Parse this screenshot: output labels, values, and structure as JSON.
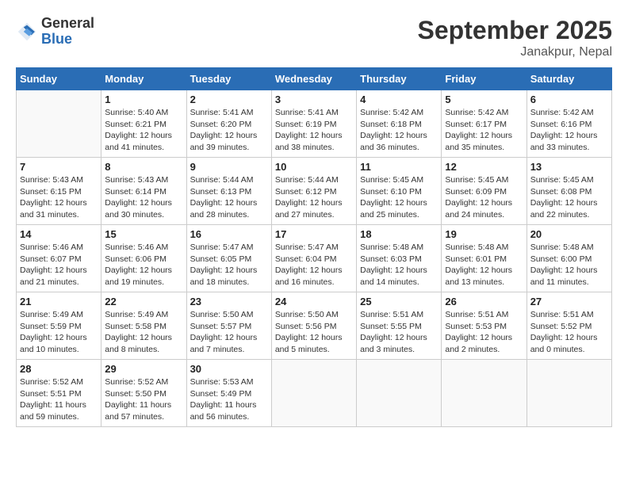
{
  "header": {
    "logo_general": "General",
    "logo_blue": "Blue",
    "month": "September 2025",
    "location": "Janakpur, Nepal"
  },
  "weekdays": [
    "Sunday",
    "Monday",
    "Tuesday",
    "Wednesday",
    "Thursday",
    "Friday",
    "Saturday"
  ],
  "weeks": [
    [
      {
        "day": "",
        "empty": true
      },
      {
        "day": "1",
        "sunrise": "Sunrise: 5:40 AM",
        "sunset": "Sunset: 6:21 PM",
        "daylight": "Daylight: 12 hours and 41 minutes."
      },
      {
        "day": "2",
        "sunrise": "Sunrise: 5:41 AM",
        "sunset": "Sunset: 6:20 PM",
        "daylight": "Daylight: 12 hours and 39 minutes."
      },
      {
        "day": "3",
        "sunrise": "Sunrise: 5:41 AM",
        "sunset": "Sunset: 6:19 PM",
        "daylight": "Daylight: 12 hours and 38 minutes."
      },
      {
        "day": "4",
        "sunrise": "Sunrise: 5:42 AM",
        "sunset": "Sunset: 6:18 PM",
        "daylight": "Daylight: 12 hours and 36 minutes."
      },
      {
        "day": "5",
        "sunrise": "Sunrise: 5:42 AM",
        "sunset": "Sunset: 6:17 PM",
        "daylight": "Daylight: 12 hours and 35 minutes."
      },
      {
        "day": "6",
        "sunrise": "Sunrise: 5:42 AM",
        "sunset": "Sunset: 6:16 PM",
        "daylight": "Daylight: 12 hours and 33 minutes."
      }
    ],
    [
      {
        "day": "7",
        "sunrise": "Sunrise: 5:43 AM",
        "sunset": "Sunset: 6:15 PM",
        "daylight": "Daylight: 12 hours and 31 minutes."
      },
      {
        "day": "8",
        "sunrise": "Sunrise: 5:43 AM",
        "sunset": "Sunset: 6:14 PM",
        "daylight": "Daylight: 12 hours and 30 minutes."
      },
      {
        "day": "9",
        "sunrise": "Sunrise: 5:44 AM",
        "sunset": "Sunset: 6:13 PM",
        "daylight": "Daylight: 12 hours and 28 minutes."
      },
      {
        "day": "10",
        "sunrise": "Sunrise: 5:44 AM",
        "sunset": "Sunset: 6:12 PM",
        "daylight": "Daylight: 12 hours and 27 minutes."
      },
      {
        "day": "11",
        "sunrise": "Sunrise: 5:45 AM",
        "sunset": "Sunset: 6:10 PM",
        "daylight": "Daylight: 12 hours and 25 minutes."
      },
      {
        "day": "12",
        "sunrise": "Sunrise: 5:45 AM",
        "sunset": "Sunset: 6:09 PM",
        "daylight": "Daylight: 12 hours and 24 minutes."
      },
      {
        "day": "13",
        "sunrise": "Sunrise: 5:45 AM",
        "sunset": "Sunset: 6:08 PM",
        "daylight": "Daylight: 12 hours and 22 minutes."
      }
    ],
    [
      {
        "day": "14",
        "sunrise": "Sunrise: 5:46 AM",
        "sunset": "Sunset: 6:07 PM",
        "daylight": "Daylight: 12 hours and 21 minutes."
      },
      {
        "day": "15",
        "sunrise": "Sunrise: 5:46 AM",
        "sunset": "Sunset: 6:06 PM",
        "daylight": "Daylight: 12 hours and 19 minutes."
      },
      {
        "day": "16",
        "sunrise": "Sunrise: 5:47 AM",
        "sunset": "Sunset: 6:05 PM",
        "daylight": "Daylight: 12 hours and 18 minutes."
      },
      {
        "day": "17",
        "sunrise": "Sunrise: 5:47 AM",
        "sunset": "Sunset: 6:04 PM",
        "daylight": "Daylight: 12 hours and 16 minutes."
      },
      {
        "day": "18",
        "sunrise": "Sunrise: 5:48 AM",
        "sunset": "Sunset: 6:03 PM",
        "daylight": "Daylight: 12 hours and 14 minutes."
      },
      {
        "day": "19",
        "sunrise": "Sunrise: 5:48 AM",
        "sunset": "Sunset: 6:01 PM",
        "daylight": "Daylight: 12 hours and 13 minutes."
      },
      {
        "day": "20",
        "sunrise": "Sunrise: 5:48 AM",
        "sunset": "Sunset: 6:00 PM",
        "daylight": "Daylight: 12 hours and 11 minutes."
      }
    ],
    [
      {
        "day": "21",
        "sunrise": "Sunrise: 5:49 AM",
        "sunset": "Sunset: 5:59 PM",
        "daylight": "Daylight: 12 hours and 10 minutes."
      },
      {
        "day": "22",
        "sunrise": "Sunrise: 5:49 AM",
        "sunset": "Sunset: 5:58 PM",
        "daylight": "Daylight: 12 hours and 8 minutes."
      },
      {
        "day": "23",
        "sunrise": "Sunrise: 5:50 AM",
        "sunset": "Sunset: 5:57 PM",
        "daylight": "Daylight: 12 hours and 7 minutes."
      },
      {
        "day": "24",
        "sunrise": "Sunrise: 5:50 AM",
        "sunset": "Sunset: 5:56 PM",
        "daylight": "Daylight: 12 hours and 5 minutes."
      },
      {
        "day": "25",
        "sunrise": "Sunrise: 5:51 AM",
        "sunset": "Sunset: 5:55 PM",
        "daylight": "Daylight: 12 hours and 3 minutes."
      },
      {
        "day": "26",
        "sunrise": "Sunrise: 5:51 AM",
        "sunset": "Sunset: 5:53 PM",
        "daylight": "Daylight: 12 hours and 2 minutes."
      },
      {
        "day": "27",
        "sunrise": "Sunrise: 5:51 AM",
        "sunset": "Sunset: 5:52 PM",
        "daylight": "Daylight: 12 hours and 0 minutes."
      }
    ],
    [
      {
        "day": "28",
        "sunrise": "Sunrise: 5:52 AM",
        "sunset": "Sunset: 5:51 PM",
        "daylight": "Daylight: 11 hours and 59 minutes."
      },
      {
        "day": "29",
        "sunrise": "Sunrise: 5:52 AM",
        "sunset": "Sunset: 5:50 PM",
        "daylight": "Daylight: 11 hours and 57 minutes."
      },
      {
        "day": "30",
        "sunrise": "Sunrise: 5:53 AM",
        "sunset": "Sunset: 5:49 PM",
        "daylight": "Daylight: 11 hours and 56 minutes."
      },
      {
        "day": "",
        "empty": true
      },
      {
        "day": "",
        "empty": true
      },
      {
        "day": "",
        "empty": true
      },
      {
        "day": "",
        "empty": true
      }
    ]
  ]
}
